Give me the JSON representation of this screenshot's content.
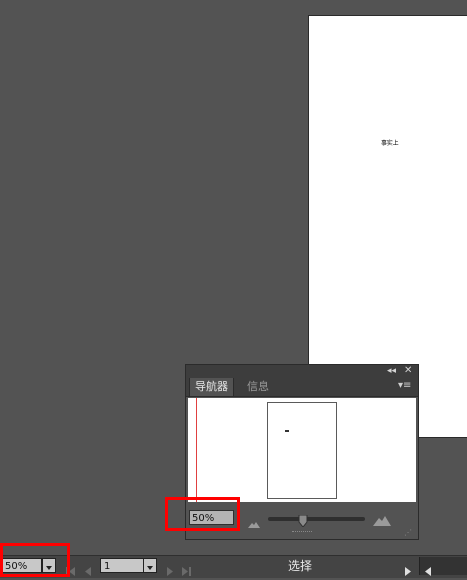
{
  "artboard": {
    "text": "事实上"
  },
  "navigator": {
    "tabs": [
      {
        "label": "导航器",
        "active": true
      },
      {
        "label": "信息",
        "active": false
      }
    ],
    "zoom_value": "50%",
    "icons": {
      "collapse": "double-chevron-left-icon",
      "close": "close-icon",
      "menu": "panel-menu-icon",
      "zoom_out": "small-mountain-icon",
      "zoom_in": "large-mountain-icon"
    }
  },
  "status_bar": {
    "zoom_value": "50%",
    "page_value": "1",
    "status_text": "选择"
  },
  "colors": {
    "canvas_bg": "#535353",
    "highlight": "#ff0000",
    "proxy_line": "#e04040"
  }
}
